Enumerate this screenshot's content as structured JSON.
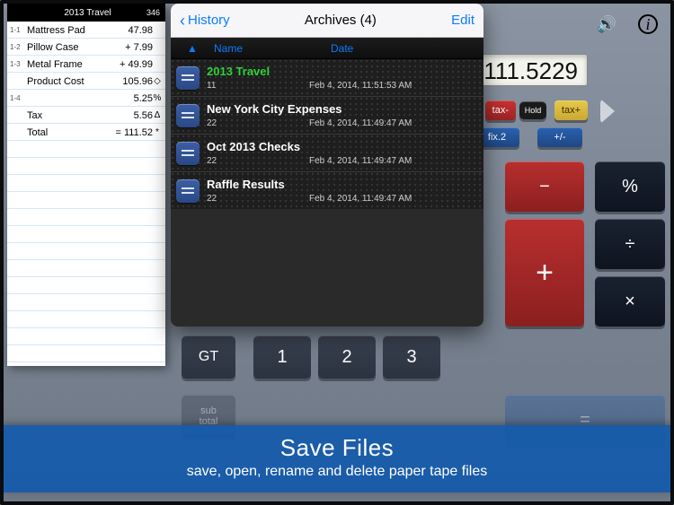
{
  "tape": {
    "title": "2013 Travel",
    "count": "346",
    "rows": [
      {
        "ln": "1-1",
        "label": "Mattress Pad",
        "val": "47.98",
        "sym": ""
      },
      {
        "ln": "1-2",
        "label": "Pillow Case",
        "val": "+ 7.99",
        "sym": ""
      },
      {
        "ln": "1-3",
        "label": "Metal Frame",
        "val": "+ 49.99",
        "sym": ""
      },
      {
        "ln": "",
        "label": "Product Cost",
        "val": "105.96",
        "sym": "◇"
      },
      {
        "ln": "1-4",
        "label": "",
        "val": "5.25",
        "sym": "%"
      },
      {
        "ln": "",
        "label": "Tax",
        "val": "5.56",
        "sym": "Δ"
      },
      {
        "ln": "",
        "label": "Total",
        "val": "= 111.52",
        "sym": "*"
      }
    ]
  },
  "display": "111.5229",
  "keys": {
    "tax_minus": "tax-",
    "tax_plus": "tax+",
    "hold": "Hold",
    "fix2": "fix.2",
    "pm": "+/-",
    "minus": "−",
    "plus": "+",
    "pct": "%",
    "div": "÷",
    "mul": "×",
    "eq": "=",
    "gt": "GT",
    "n1": "1",
    "n2": "2",
    "n3": "3",
    "sub": "sub\ntotal"
  },
  "popover": {
    "back": "History",
    "title": "Archives (4)",
    "edit": "Edit",
    "cols": {
      "sort": "▲",
      "name": "Name",
      "date": "Date"
    },
    "items": [
      {
        "title": "2013 Travel",
        "count": "11",
        "date": "Feb 4, 2014, 11:51:53 AM",
        "active": true
      },
      {
        "title": "New York City Expenses",
        "count": "22",
        "date": "Feb 4, 2014, 11:49:47 AM",
        "active": false
      },
      {
        "title": "Oct 2013 Checks",
        "count": "22",
        "date": "Feb 4, 2014, 11:49:47 AM",
        "active": false
      },
      {
        "title": "Raffle Results",
        "count": "22",
        "date": "Feb 4, 2014, 11:49:47 AM",
        "active": false
      }
    ]
  },
  "caption": {
    "title": "Save Files",
    "subtitle": "save, open, rename and delete paper tape files"
  }
}
